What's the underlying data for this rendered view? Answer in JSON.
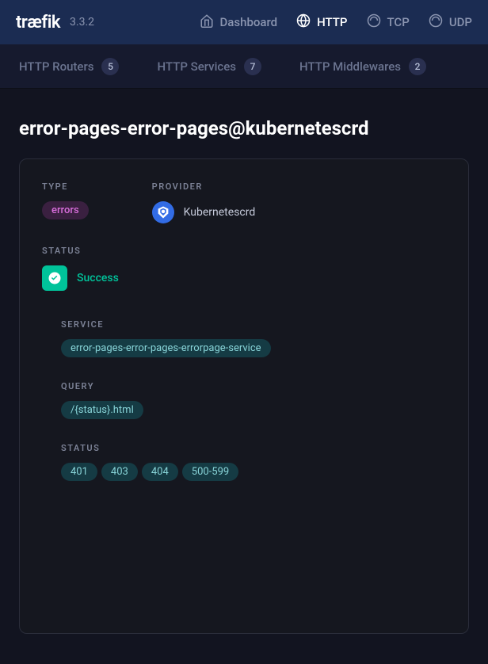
{
  "logo": "træfik",
  "version": "3.3.2",
  "nav": {
    "dashboard": "Dashboard",
    "http": "HTTP",
    "tcp": "TCP",
    "udp": "UDP"
  },
  "subnav": {
    "routers": {
      "label": "HTTP Routers",
      "count": "5"
    },
    "services": {
      "label": "HTTP Services",
      "count": "7"
    },
    "middlewares": {
      "label": "HTTP Middlewares",
      "count": "2"
    }
  },
  "page_title": "error-pages-error-pages@kubernetescrd",
  "labels": {
    "type": "TYPE",
    "provider": "PROVIDER",
    "status": "STATUS",
    "service": "SERVICE",
    "query": "QUERY",
    "status_codes": "STATUS"
  },
  "type_value": "errors",
  "provider_name": "Kubernetescrd",
  "status_value": "Success",
  "service_value": "error-pages-error-pages-errorpage-service",
  "query_value": "/{status}.html",
  "status_codes": [
    "401",
    "403",
    "404",
    "500-599"
  ]
}
